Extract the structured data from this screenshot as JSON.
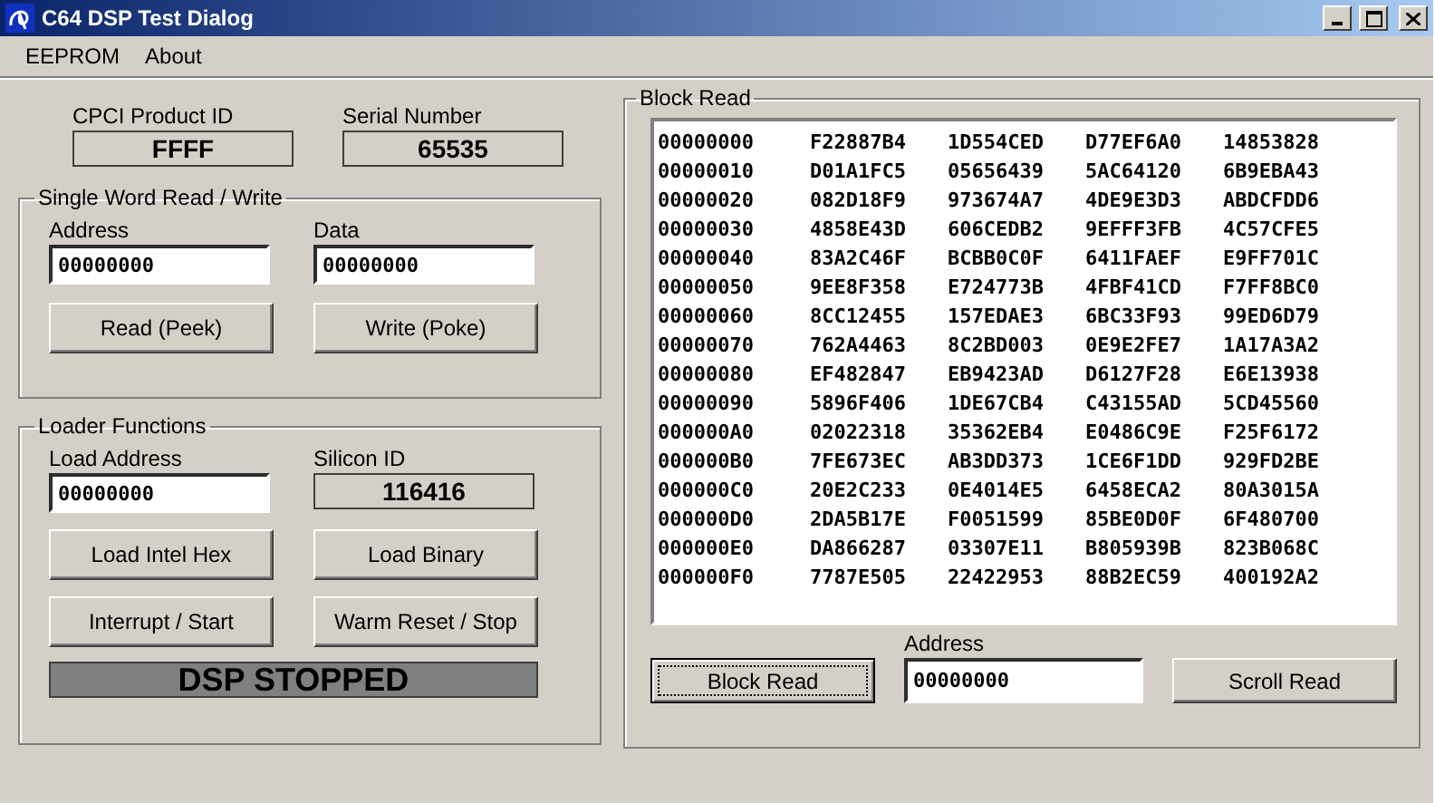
{
  "window": {
    "title": "C64 DSP Test Dialog"
  },
  "menu": [
    "EEPROM",
    "About"
  ],
  "product_id": {
    "label": "CPCI Product ID",
    "value": "FFFF"
  },
  "serial_number": {
    "label": "Serial Number",
    "value": "65535"
  },
  "single_word": {
    "title": "Single Word Read / Write",
    "address": {
      "label": "Address",
      "value": "00000000"
    },
    "data": {
      "label": "Data",
      "value": "00000000"
    },
    "buttons": [
      "Read (Peek)",
      "Write (Poke)"
    ]
  },
  "loader": {
    "title": "Loader Functions",
    "load_address": {
      "label": "Load Address",
      "value": "00000000"
    },
    "silicon_id": {
      "label": "Silicon ID",
      "value": "116416"
    },
    "buttons": [
      "Load Intel Hex",
      "Load Binary",
      "Interrupt / Start",
      "Warm Reset / Stop"
    ],
    "status": "DSP STOPPED"
  },
  "block_read": {
    "title": "Block Read",
    "rows": [
      {
        "address": "00000000",
        "words": [
          "F22887B4",
          "1D554CED",
          "D77EF6A0",
          "14853828"
        ]
      },
      {
        "address": "00000010",
        "words": [
          "D01A1FC5",
          "05656439",
          "5AC64120",
          "6B9EBA43"
        ]
      },
      {
        "address": "00000020",
        "words": [
          "082D18F9",
          "973674A7",
          "4DE9E3D3",
          "ABDCFDD6"
        ]
      },
      {
        "address": "00000030",
        "words": [
          "4858E43D",
          "606CEDB2",
          "9EFFF3FB",
          "4C57CFE5"
        ]
      },
      {
        "address": "00000040",
        "words": [
          "83A2C46F",
          "BCBB0C0F",
          "6411FAEF",
          "E9FF701C"
        ]
      },
      {
        "address": "00000050",
        "words": [
          "9EE8F358",
          "E724773B",
          "4FBF41CD",
          "F7FF8BC0"
        ]
      },
      {
        "address": "00000060",
        "words": [
          "8CC12455",
          "157EDAE3",
          "6BC33F93",
          "99ED6D79"
        ]
      },
      {
        "address": "00000070",
        "words": [
          "762A4463",
          "8C2BD003",
          "0E9E2FE7",
          "1A17A3A2"
        ]
      },
      {
        "address": "00000080",
        "words": [
          "EF482847",
          "EB9423AD",
          "D6127F28",
          "E6E13938"
        ]
      },
      {
        "address": "00000090",
        "words": [
          "5896F406",
          "1DE67CB4",
          "C43155AD",
          "5CD45560"
        ]
      },
      {
        "address": "000000A0",
        "words": [
          "02022318",
          "35362EB4",
          "E0486C9E",
          "F25F6172"
        ]
      },
      {
        "address": "000000B0",
        "words": [
          "7FE673EC",
          "AB3DD373",
          "1CE6F1DD",
          "929FD2BE"
        ]
      },
      {
        "address": "000000C0",
        "words": [
          "20E2C233",
          "0E4014E5",
          "6458ECA2",
          "80A3015A"
        ]
      },
      {
        "address": "000000D0",
        "words": [
          "2DA5B17E",
          "F0051599",
          "85BE0D0F",
          "6F480700"
        ]
      },
      {
        "address": "000000E0",
        "words": [
          "DA866287",
          "03307E11",
          "B805939B",
          "823B068C"
        ]
      },
      {
        "address": "000000F0",
        "words": [
          "7787E505",
          "22422953",
          "88B2EC59",
          "400192A2"
        ]
      }
    ],
    "address": {
      "label": "Address",
      "value": "00000000"
    },
    "buttons": [
      {
        "label": "Block Read",
        "focused": true
      },
      {
        "label": "Scroll Read",
        "focused": false
      }
    ]
  }
}
